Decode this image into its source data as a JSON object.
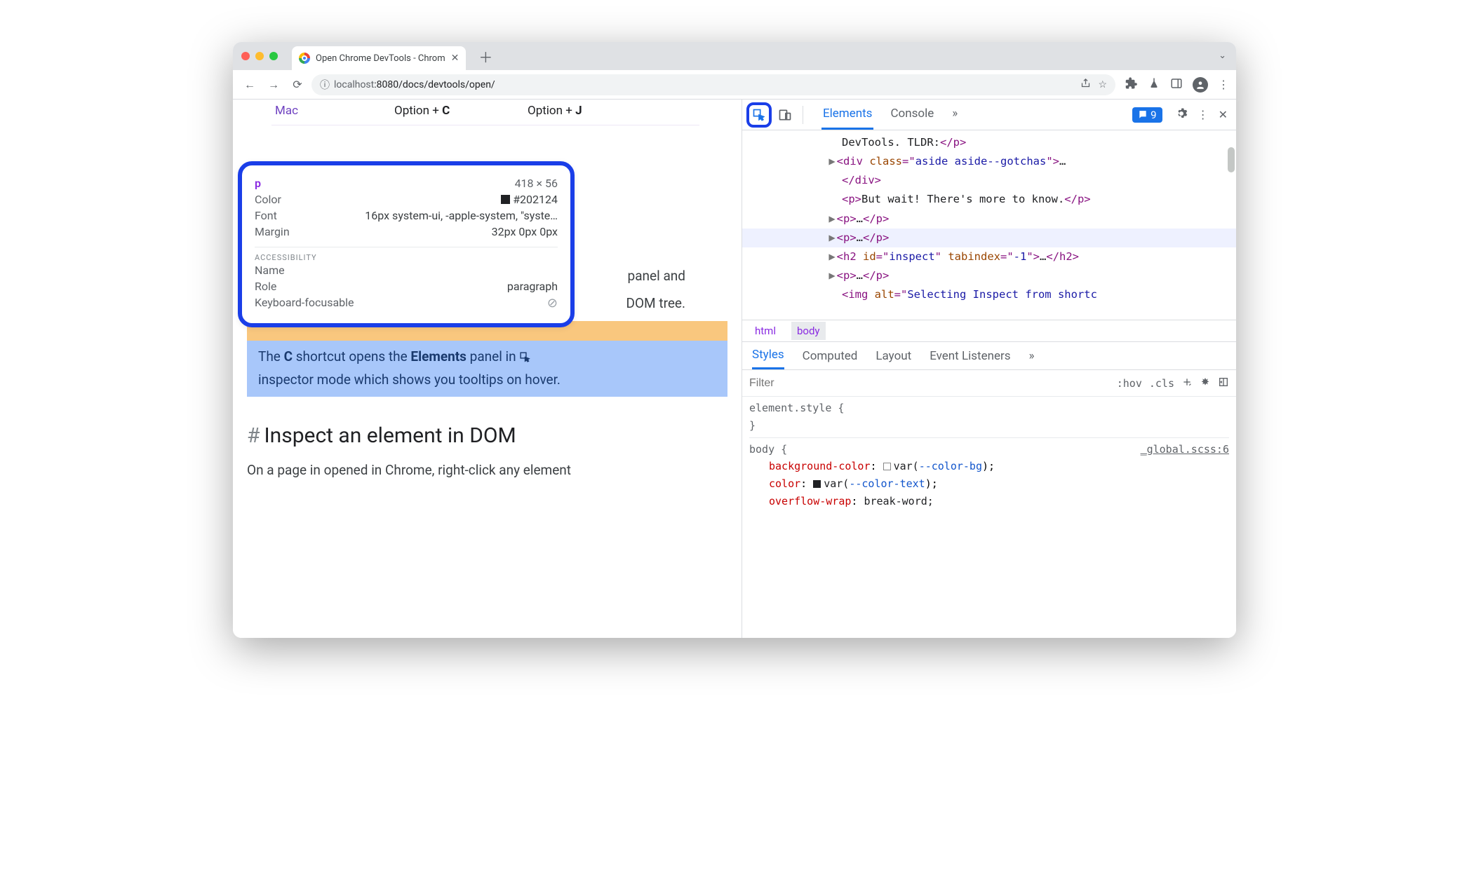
{
  "tab": {
    "title": "Open Chrome DevTools - Chrom"
  },
  "address": {
    "prefix": "localhost",
    "rest": ":8080/docs/devtools/open/"
  },
  "shortcuts": {
    "mac_label": "Mac",
    "opt_c": "Option + ",
    "opt_c_key": "C",
    "opt_j": "Option + ",
    "opt_j_key": "J"
  },
  "tooltip": {
    "tag": "p",
    "dims": "418 × 56",
    "color_label": "Color",
    "color_value": "#202124",
    "font_label": "Font",
    "font_value": "16px system-ui, -apple-system, \"syste…",
    "margin_label": "Margin",
    "margin_value": "32px 0px 0px",
    "acc_header": "ACCESSIBILITY",
    "name_label": "Name",
    "role_label": "Role",
    "role_value": "paragraph",
    "kbd_label": "Keyboard-focusable"
  },
  "page": {
    "rtext1": "panel and",
    "rtext2": "DOM tree.",
    "hl_text_1": "The ",
    "hl_c": "C",
    "hl_text_2": " shortcut opens the ",
    "hl_elements": "Elements",
    "hl_text_3": " panel in ",
    "hl_text_4": "inspector mode which shows you tooltips on hover.",
    "h2": "Inspect an element in DOM",
    "para": "On a page in opened in Chrome, right-click any element"
  },
  "devtools": {
    "tabs": {
      "elements": "Elements",
      "console": "Console"
    },
    "badge_count": "9",
    "dom": {
      "l0a": "DevTools. TLDR:",
      "l0b": "</p>",
      "l1a": "<div ",
      "l1b": "class",
      "l1c": "=\"",
      "l1d": "aside aside--gotchas",
      "l1e": "\">",
      "l1f": "…",
      "l2": "</div>",
      "l3a": "<p>",
      "l3b": "But wait! There's more to know.",
      "l3c": "</p>",
      "l4a": "<p>",
      "l4b": "…",
      "l4c": "</p>",
      "l5a": "<p>",
      "l5b": "…",
      "l5c": "</p>",
      "l6a": "<h2 ",
      "l6b": "id",
      "l6c": "=\"",
      "l6d": "inspect",
      "l6e": "\" ",
      "l6f": "tabindex",
      "l6g": "=\"",
      "l6h": "-1",
      "l6i": "\">",
      "l6j": "…",
      "l6k": "</h2>",
      "l7a": "<p>",
      "l7b": "…",
      "l7c": "</p>",
      "l8a": "<img ",
      "l8b": "alt",
      "l8c": "=\"",
      "l8d": "Selecting Inspect from shortc"
    },
    "crumbs": {
      "html": "html",
      "body": "body"
    },
    "styles_tabs": {
      "styles": "Styles",
      "computed": "Computed",
      "layout": "Layout",
      "listeners": "Event Listeners"
    },
    "filter": {
      "placeholder": "Filter",
      "hov": ":hov",
      "cls": ".cls"
    },
    "css": {
      "elstyle": "element.style {",
      "close": "}",
      "body_sel": "body {",
      "src": "_global.scss:6",
      "p1": "background-color",
      "v1a": "var(",
      "v1b": "--color-bg",
      "v1c": ");",
      "p2": "color",
      "v2a": "var(",
      "v2b": "--color-text",
      "v2c": ");",
      "p3": "overflow-wrap",
      "v3": "break-word;"
    }
  }
}
